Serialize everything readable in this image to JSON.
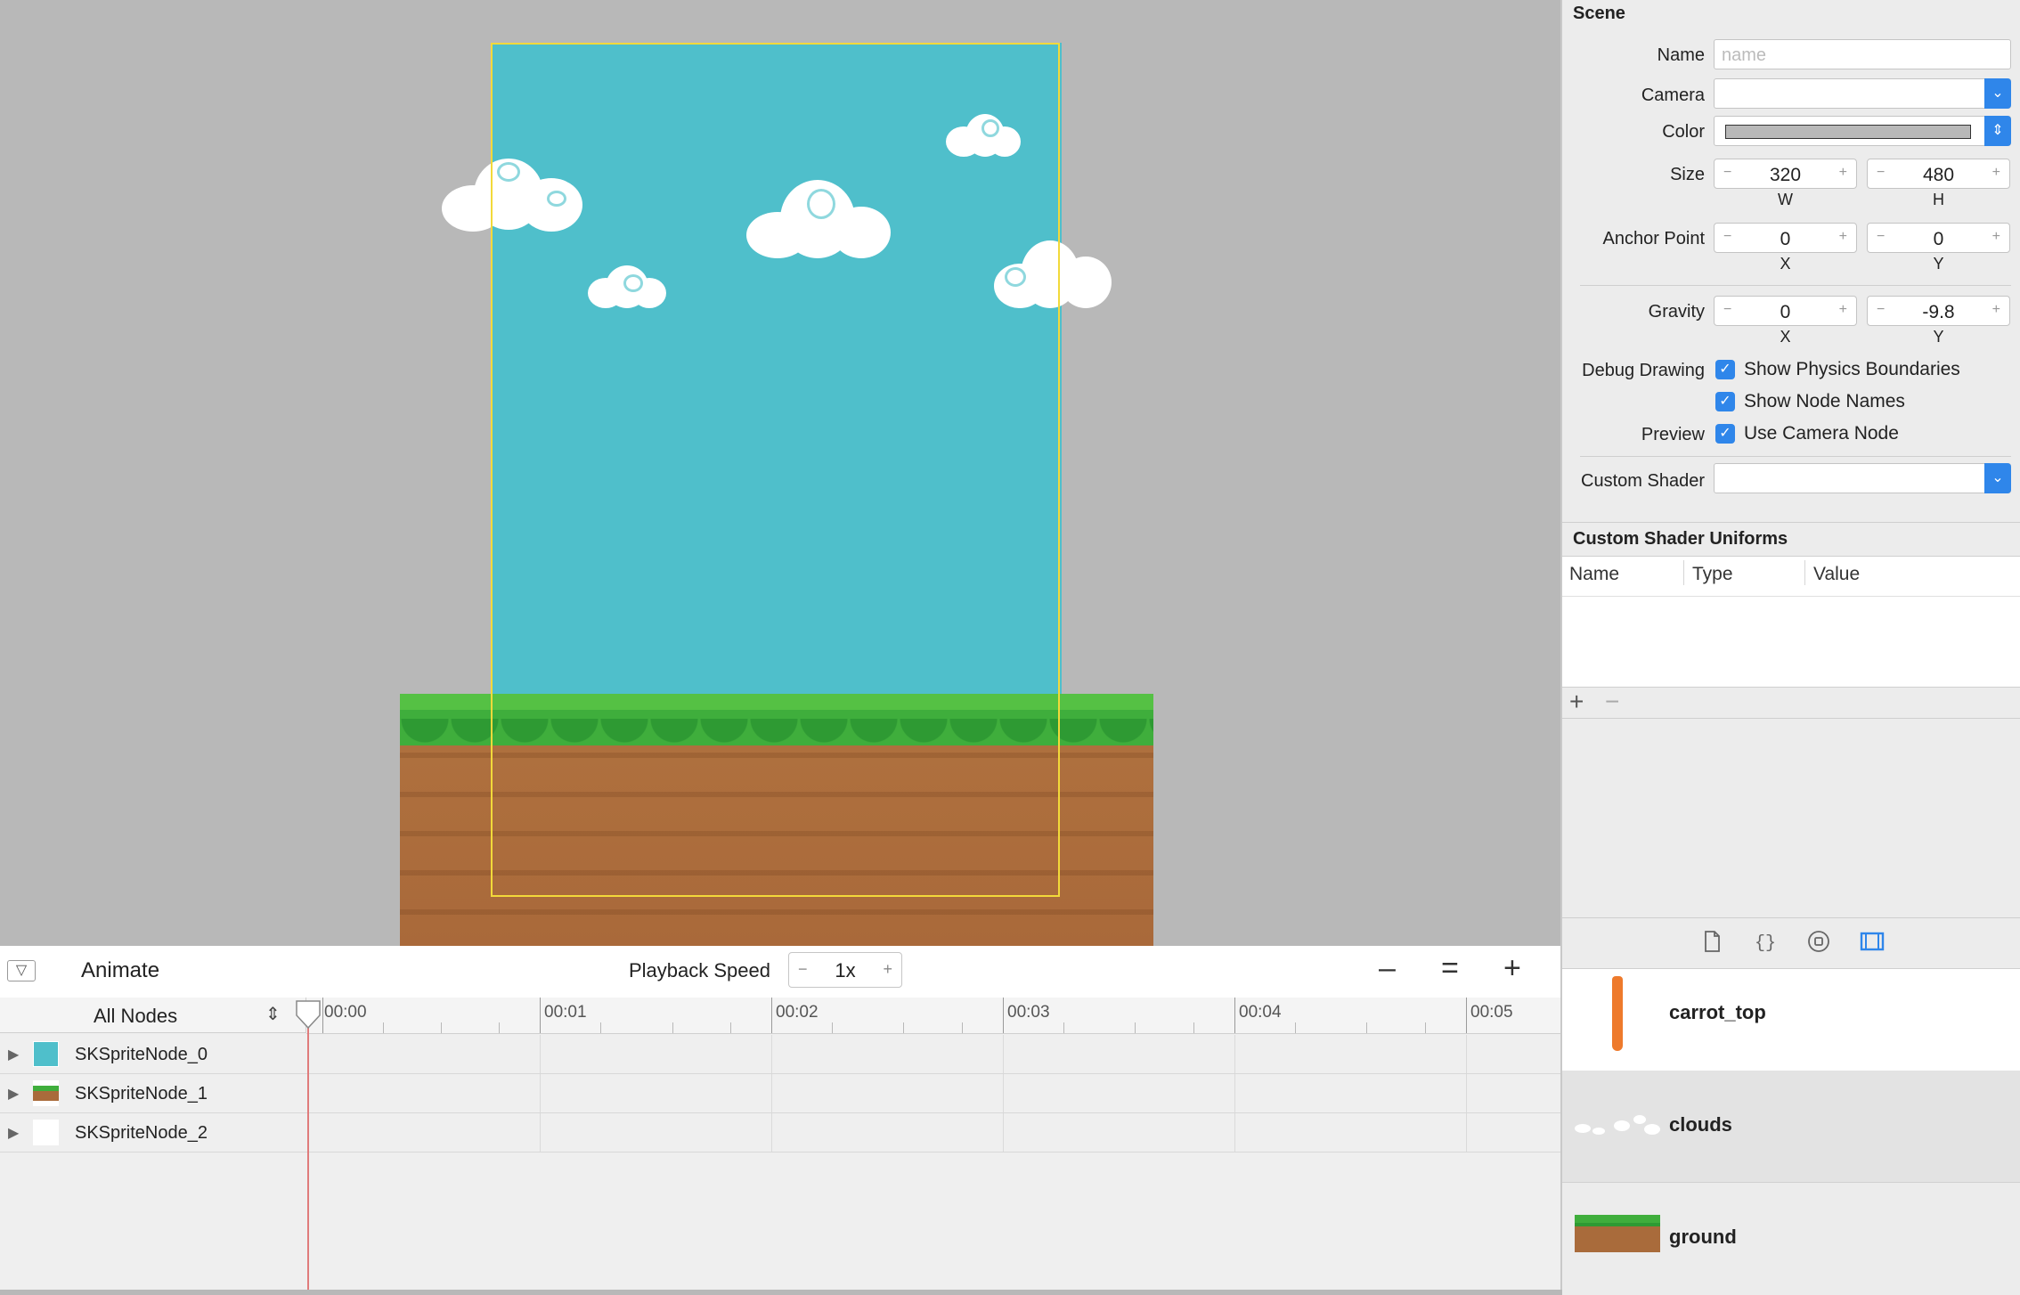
{
  "timeline": {
    "animate_label": "Animate",
    "playback_label": "Playback Speed",
    "playback_value": "1x",
    "all_nodes": "All Nodes",
    "ticks": [
      "00:00",
      "00:01",
      "00:02",
      "00:03",
      "00:04",
      "00:05"
    ],
    "rows": [
      {
        "name": "SKSpriteNode_0",
        "thumb_color": "#4fbfcb"
      },
      {
        "name": "SKSpriteNode_1",
        "thumb_color": "#a96b3b"
      },
      {
        "name": "SKSpriteNode_2",
        "thumb_color": "#ffffff"
      }
    ],
    "playhead_time": "00:00"
  },
  "inspector": {
    "section_title": "Scene",
    "name_label": "Name",
    "name_placeholder": "name",
    "camera_label": "Camera",
    "color_label": "Color",
    "size_label": "Size",
    "size_w": "320",
    "size_h": "480",
    "w_label": "W",
    "h_label": "H",
    "anchor_label": "Anchor Point",
    "anchor_x": "0",
    "anchor_y": "0",
    "x_label": "X",
    "y_label": "Y",
    "gravity_label": "Gravity",
    "gravity_x": "0",
    "gravity_y": "-9.8",
    "debug_label": "Debug Drawing",
    "show_physics": "Show Physics Boundaries",
    "show_names": "Show Node Names",
    "preview_label": "Preview",
    "use_camera": "Use Camera Node",
    "shader_label": "Custom Shader",
    "uniforms_title": "Custom Shader Uniforms",
    "col_name": "Name",
    "col_type": "Type",
    "col_value": "Value"
  },
  "library": {
    "items": [
      {
        "label": "carrot_top"
      },
      {
        "label": "clouds"
      },
      {
        "label": "ground"
      }
    ]
  },
  "colors": {
    "accent": "#2f86ea",
    "sky": "#4fbfcb",
    "scene_frame": "#f2d93a",
    "playhead": "#e07b7b"
  }
}
